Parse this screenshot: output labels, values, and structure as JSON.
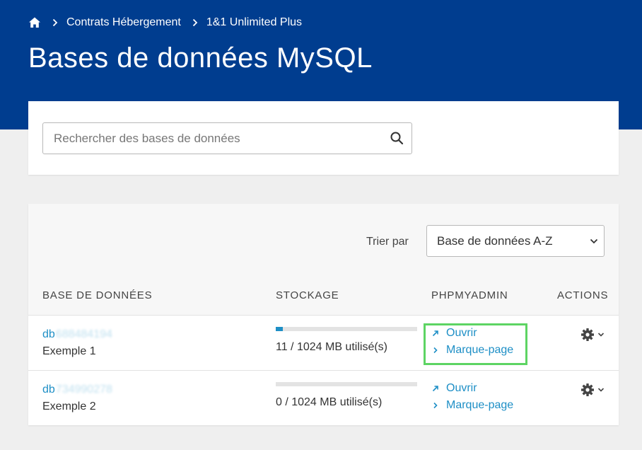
{
  "breadcrumb": {
    "items": [
      "Contrats Hébergement",
      "1&1 Unlimited Plus"
    ]
  },
  "page": {
    "title": "Bases de données MySQL"
  },
  "search": {
    "placeholder": "Rechercher des bases de données",
    "value": ""
  },
  "sort": {
    "label": "Trier par",
    "selected": "Base de données A-Z"
  },
  "table": {
    "columns": [
      "BASE DE DONNÉES",
      "STOCKAGE",
      "PHPMYADMIN",
      "ACTIONS"
    ],
    "rows": [
      {
        "db_prefix": "db",
        "db_rest": "688484194",
        "label": "Exemple 1",
        "storage_used": 11,
        "storage_total": 1024,
        "storage_text": "11 / 1024 MB utilisé(s)",
        "open_label": "Ouvrir",
        "bookmark_label": "Marque-page"
      },
      {
        "db_prefix": "db",
        "db_rest": "734990278",
        "label": "Exemple 2",
        "storage_used": 0,
        "storage_total": 1024,
        "storage_text": "0 / 1024 MB utilisé(s)",
        "open_label": "Ouvrir",
        "bookmark_label": "Marque-page"
      }
    ]
  },
  "icons": [
    "home-icon",
    "chevron-right-icon",
    "search-icon",
    "chevron-down-icon",
    "external-link-icon",
    "chevron-right-small-icon",
    "gear-icon"
  ],
  "colors": {
    "header_bg": "#003d8f",
    "link": "#1e8fc6",
    "highlight": "#5dd463"
  }
}
